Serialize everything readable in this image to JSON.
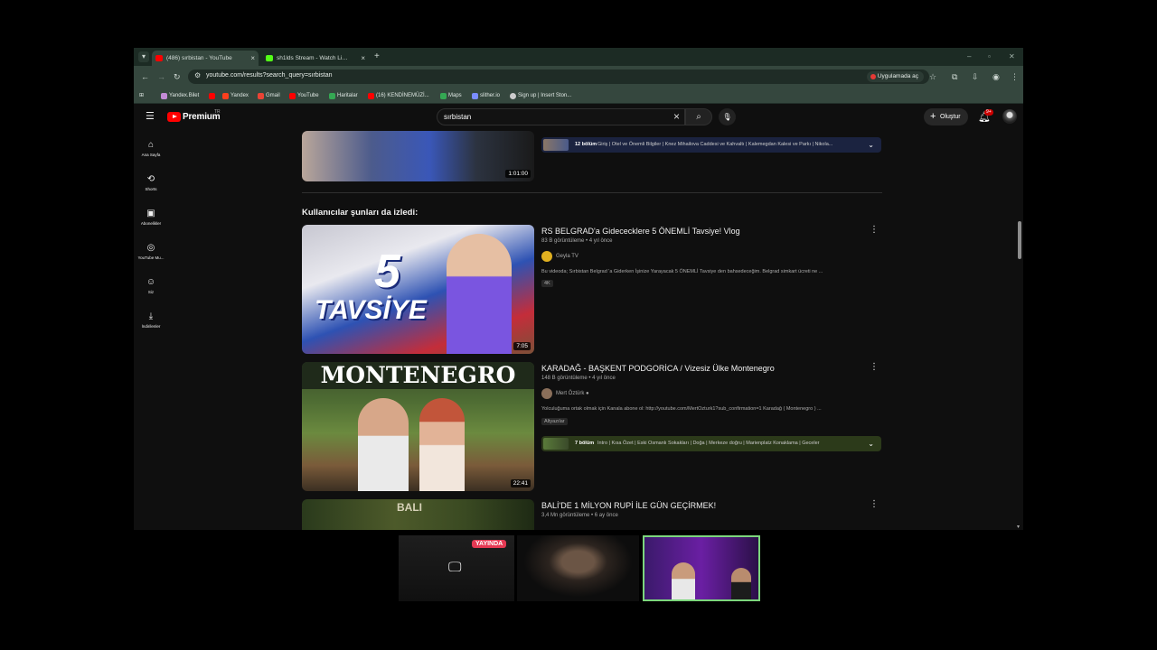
{
  "browser": {
    "tabs": [
      {
        "title": "(486) sırbistan - YouTube",
        "favicon_color": "#ff0000",
        "active": true
      },
      {
        "title": "sh1lds Stream - Watch Live on Kick",
        "favicon_color": "#53fc18",
        "active": false
      }
    ],
    "url": "youtube.com/results?search_query=sırbistan",
    "open_in_app": "Uygulamada aç",
    "bookmarks": [
      {
        "label": "Yandex.Bilet",
        "color": "#c38bd6"
      },
      {
        "label": "",
        "color": "#ff0000"
      },
      {
        "label": "Yandex",
        "color": "#fc3f1d"
      },
      {
        "label": "Gmail",
        "color": "#ea4335"
      },
      {
        "label": "YouTube",
        "color": "#ff0000"
      },
      {
        "label": "Haritalar",
        "color": "#34a853"
      },
      {
        "label": "(16) KENDİNEMÜZİ...",
        "color": "#ff0000"
      },
      {
        "label": "Maps",
        "color": "#34a853"
      },
      {
        "label": "slither.io",
        "color": "#7a8cff"
      },
      {
        "label": "Sign up | Insert Ston...",
        "color": "#cccccc"
      }
    ]
  },
  "youtube": {
    "logo_text": "Premium",
    "country_code": "TR",
    "search_query": "sırbistan",
    "create_label": "Oluştur",
    "notification_count": "9+",
    "sidebar": [
      {
        "label": "Ana Sayfa",
        "icon": "home-icon"
      },
      {
        "label": "Shorts",
        "icon": "shorts-icon"
      },
      {
        "label": "Abonelikler",
        "icon": "subscriptions-icon"
      },
      {
        "label": "YouTube Mu...",
        "icon": "youtube-music-icon"
      },
      {
        "label": "Siz",
        "icon": "you-icon"
      },
      {
        "label": "İndirilenler",
        "icon": "downloads-icon"
      }
    ],
    "top_video": {
      "duration": "1:01:00",
      "chapters": {
        "count": "12 bölüm",
        "text": "Giriş | Otel ve Önemli Bilgiler | Knez Mihailova Caddesi ve Kahvaltı | Kalemegdan Kalesi ve Parkı | Nikola..."
      }
    },
    "section_title": "Kullanıcılar şunları da izledi:",
    "videos": [
      {
        "title": "RS BELGRAD'a Gidececklere 5 ÖNEMLİ Tavsiye! Vlog",
        "meta": "83 B görüntüleme • 4 yıl önce",
        "channel": "Geyla TV",
        "channel_color": "#e0b020",
        "description": "Bu videoda; Sırbistan Belgrad 'a Giderken İşinize Yarayacak 5 ÖNEMLİ Tavsiye den bahsedeceğim. Belgrad simkart ücreti ne ...",
        "tag": "4K",
        "duration": "7:05",
        "thumb_big": "5",
        "thumb_word": "TAVSİYE"
      },
      {
        "title": "KARADAĞ - BAŞKENT PODGORİCA / Vizesiz Ülke Montenegro",
        "meta": "148 B görüntüleme • 4 yıl önce",
        "channel": "Mert Öztürk",
        "channel_color": "#8a6f5a",
        "description": "Yolculuğuma ortak olmak için Kanala abone ol: http://youtube.com/MertOzturk1?sub_confirmation=1 Karadağ ( Montenegro ) ...",
        "tag": "Altyazılar",
        "duration": "22:41",
        "thumb_word": "MONTENEGRO",
        "chapters": {
          "count": "7 bölüm",
          "text": "Intro | Kısa Özet | Eski Osmanlı Sokakları | Doğa | Merkeze doğru | Marienplatz Konaklama | Geceler"
        }
      },
      {
        "title": "BALİ'DE 1 MİLYON RUPİ İLE GÜN GEÇİRMEK!",
        "meta": "3,4 Mn görüntüleme • 6 ay önce",
        "thumb_word": "BALI"
      }
    ]
  },
  "stream_overlay": {
    "live_label": "YAYINDA"
  }
}
